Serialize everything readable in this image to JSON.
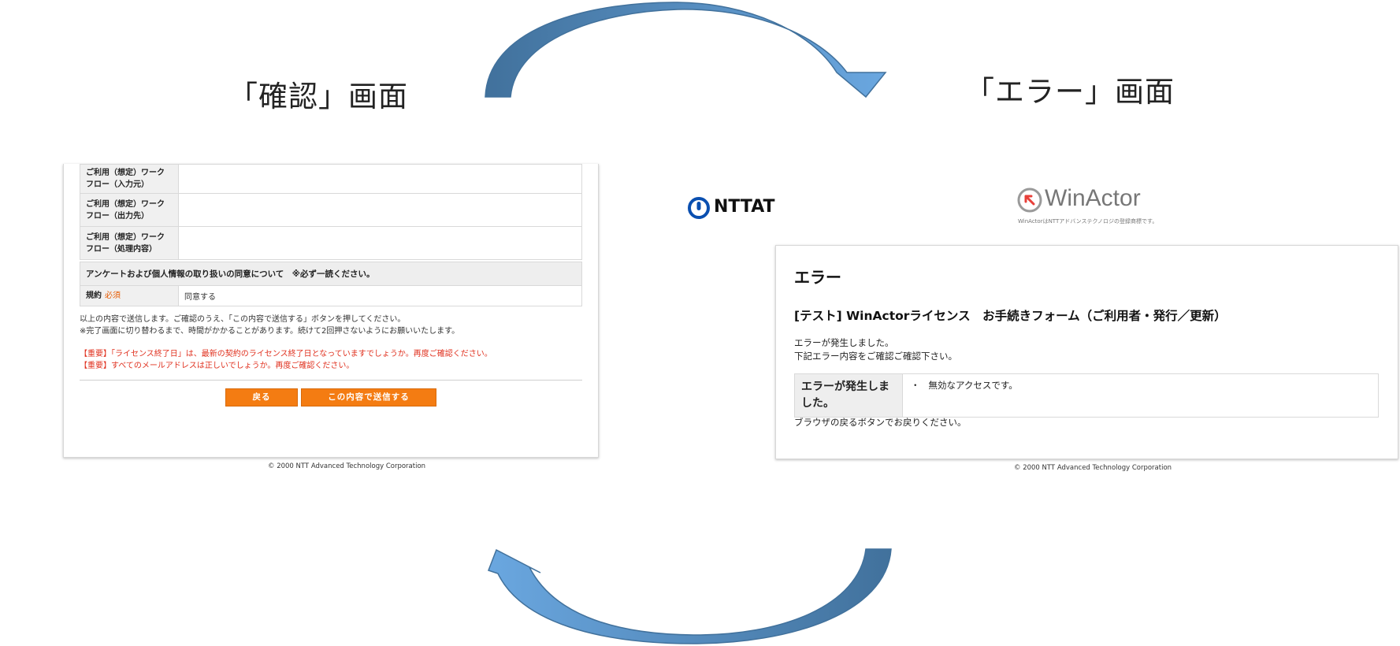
{
  "labels": {
    "confirm_screen": "「確認」画面",
    "error_screen": "「エラー」画面"
  },
  "confirm": {
    "rows": [
      {
        "label_line1": "ご利用（想定）ワーク",
        "label_line2": "フロー（入力元）",
        "value": ""
      },
      {
        "label_line1": "ご利用（想定）ワーク",
        "label_line2": "フロー（出力先）",
        "value": ""
      },
      {
        "label_line1": "ご利用（想定）ワーク",
        "label_line2": "フロー（処理内容）",
        "value": ""
      }
    ],
    "section_heading": "アンケートおよび個人情報の取り扱いの同意について　※必ず一読ください。",
    "agreement": {
      "label": "規約",
      "required": "必須",
      "value": "同意する"
    },
    "notes": [
      "以上の内容で送信します。ご確認のうえ、「この内容で送信する」ボタンを押してください。",
      "※完了画面に切り替わるまで、時間がかかることがあります。続けて2回押さないようにお願いいたします。"
    ],
    "warnings": [
      "【重要】「ライセンス終了日」は、最新の契約のライセンス終了日となっていますでしょうか。再度ご確認ください。",
      "【重要】すべてのメールアドレスは正しいでしょうか。再度ご確認ください。"
    ],
    "back_button": "戻る",
    "submit_button": "この内容で送信する",
    "copyright": "© 2000 NTT Advanced Technology Corporation"
  },
  "error": {
    "ntt_logo": "NTTAT",
    "winactor_logo": "WinActor",
    "winactor_tagline": "WinActorはNTTアドバンステクノロジの登録商標です。",
    "heading": "エラー",
    "form_title": "[テスト] WinActorライセンス　お手続きフォーム（ご利用者・発行／更新）",
    "message_line1": "エラーが発生しました。",
    "message_line2": "下記エラー内容をご確認ご確認下さい。",
    "table_label_line1": "エラーが発生しま",
    "table_label_line2": "した。",
    "table_bullet": "・",
    "table_value": "無効なアクセスです。",
    "footer_note": "ブラウザの戻るボタンでお戻りください。",
    "copyright": "© 2000 NTT Advanced Technology Corporation"
  },
  "colors": {
    "arrow_light": "#5b9bd5",
    "arrow_dark": "#41719c",
    "orange_button": "#f47c12",
    "warning_red": "#e0301e"
  }
}
